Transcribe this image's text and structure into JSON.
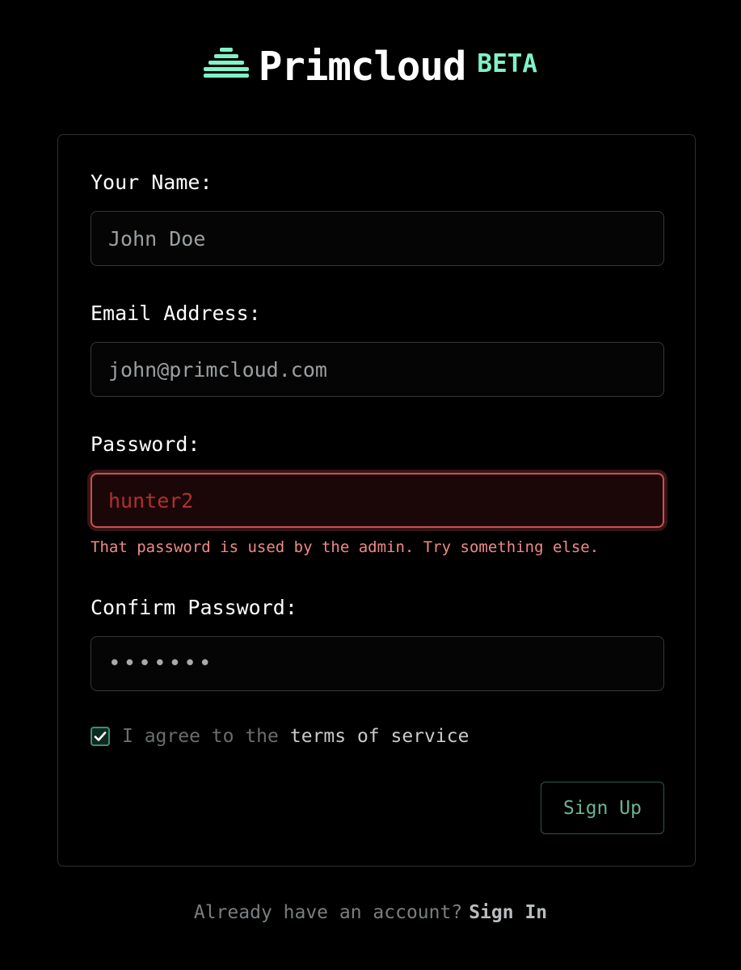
{
  "brand": {
    "name": "Primcloud",
    "badge": "BETA",
    "accent_color": "#7ff2c7",
    "logo_icon": "stacked-bars-logo-icon"
  },
  "form": {
    "name": {
      "label": "Your Name:",
      "placeholder": "John Doe"
    },
    "email": {
      "label": "Email Address:",
      "placeholder": "john@primcloud.com"
    },
    "password": {
      "label": "Password:",
      "value": "hunter2",
      "error": "That password is used by the admin. Try something else.",
      "error_color": "#f08a86"
    },
    "confirm_password": {
      "label": "Confirm Password:",
      "value": "•••••••"
    },
    "terms": {
      "checked": true,
      "text": "I agree to the",
      "link": "terms of service"
    },
    "submit_label": "Sign Up"
  },
  "footer": {
    "prompt": "Already have an account?",
    "link": "Sign In"
  }
}
